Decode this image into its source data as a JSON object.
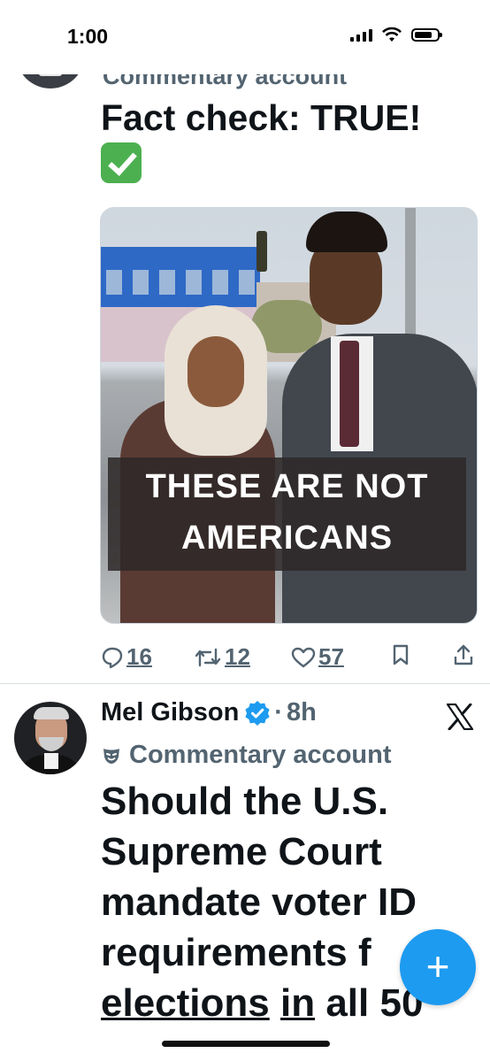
{
  "status_bar": {
    "time": "1:00"
  },
  "tweet1": {
    "badge_label": "Commentary account",
    "text": "Fact check: TRUE!",
    "image": {
      "overlay_line1": "THESE ARE NOT",
      "overlay_line2": "AMERICANS"
    },
    "actions": {
      "replies": "16",
      "reposts": "12",
      "likes": "57"
    }
  },
  "tweet2": {
    "author_name": "Mel Gibson",
    "separator": "·",
    "time": "8h",
    "badge_label": "Commentary account",
    "text_line1": "Should the U.S.",
    "text_line2": "Supreme Court",
    "text_line3": "mandate voter ID",
    "text_line4": "requirements f",
    "text_line5a": "elections",
    "text_line5b": "in",
    "text_line5c": "all 50"
  },
  "fab": {
    "label": "+"
  },
  "colors": {
    "accent": "#1d9bf0",
    "muted": "#536471",
    "text": "#0f1419",
    "check": "#4cb050"
  },
  "icons": [
    "reply-icon",
    "repost-icon",
    "like-icon",
    "bookmark-icon",
    "share-icon",
    "verified-badge-icon",
    "x-logo-icon",
    "commentary-mask-icon",
    "signal-icon",
    "wifi-icon",
    "battery-icon",
    "check-mark-emoji"
  ]
}
